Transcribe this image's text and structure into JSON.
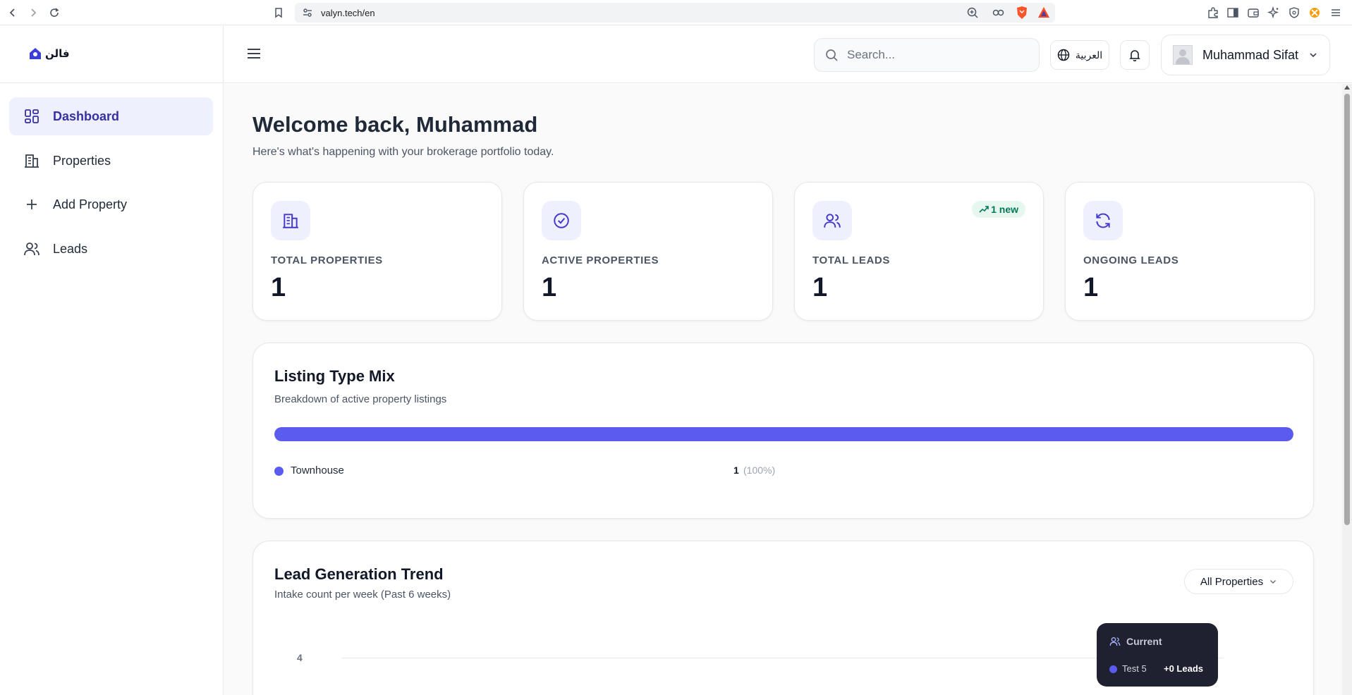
{
  "browser": {
    "url": "valyn.tech/en"
  },
  "sidebar": {
    "logo_text": "فالن",
    "items": [
      {
        "label": "Dashboard",
        "icon": "dashboard-icon"
      },
      {
        "label": "Properties",
        "icon": "building-icon"
      },
      {
        "label": "Add Property",
        "icon": "plus-icon"
      },
      {
        "label": "Leads",
        "icon": "users-icon"
      }
    ]
  },
  "header": {
    "search_placeholder": "Search...",
    "language_label": "العربية",
    "user_name": "Muhammad Sifat"
  },
  "main": {
    "welcome_title": "Welcome back, Muhammad",
    "welcome_subtitle": "Here's what's happening with your brokerage portfolio today.",
    "stats": [
      {
        "label": "TOTAL PROPERTIES",
        "value": "1",
        "icon": "building-icon"
      },
      {
        "label": "ACTIVE PROPERTIES",
        "value": "1",
        "icon": "check-circle-icon"
      },
      {
        "label": "TOTAL LEADS",
        "value": "1",
        "icon": "users-icon",
        "badge": "1 new"
      },
      {
        "label": "ONGOING LEADS",
        "value": "1",
        "icon": "refresh-icon"
      }
    ],
    "listing_mix": {
      "title": "Listing Type Mix",
      "subtitle": "Breakdown of active property listings",
      "items": [
        {
          "name": "Townhouse",
          "count": "1",
          "percent": "(100%)",
          "share": 1.0
        }
      ]
    },
    "lead_trend": {
      "title": "Lead Generation Trend",
      "subtitle": "Intake count per week (Past 6 weeks)",
      "filter_label": "All Properties",
      "y_tick": "4",
      "tooltip": {
        "heading": "Current",
        "series_name": "Test 5",
        "series_value": "+0 Leads"
      }
    }
  },
  "colors": {
    "accent": "#5b5bf0",
    "active_nav_bg": "#eef0fe",
    "badge_green": "#047857"
  }
}
